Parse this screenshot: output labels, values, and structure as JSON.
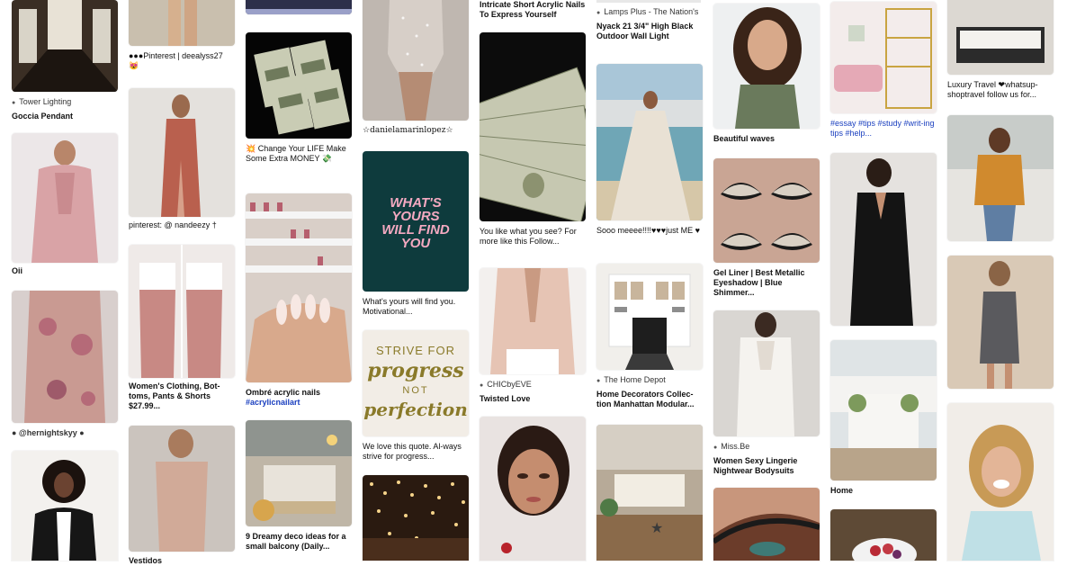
{
  "colors": {
    "link": "#1a3fbf",
    "quote_pink": "#f4a9c1",
    "quote_bg_dark": "#0e3b3d",
    "progress_gold": "#8a7a2a"
  },
  "pins": {
    "c1_1": {
      "source": "Tower Lighting",
      "title": "Goccia Pendant"
    },
    "c1_2": {
      "title": "Oii"
    },
    "c1_3": {
      "source": "● @hernightskyy ●"
    },
    "c2_1": {
      "title": "●●●Pinterest | deealyss27 😻"
    },
    "c2_2": {
      "title": "pinterest: @ nandeezy †"
    },
    "c2_3": {
      "title": "Women's Clothing, Bot-toms, Pants & Shorts $27.99..."
    },
    "c2_4": {
      "title": "Vestidos"
    },
    "c3_2": {
      "title": "💥 Change Your LIFE Make Some Extra MONEY 💸"
    },
    "c3_3": {
      "title": "Ombré acrylic nails",
      "tag": "#acrylicnailart"
    },
    "c3_4": {
      "title": "9 Dreamy deco ideas for a small balcony (Daily..."
    },
    "c4_1": {
      "overlay": "☆danielamarinlopez☆"
    },
    "c4_2": {
      "quote": [
        "WHAT'S",
        "YOURS",
        "WILL FIND",
        "YOU"
      ],
      "title": "What's yours will find you. Motivational..."
    },
    "c4_3": {
      "quote": [
        "STRIVE FOR",
        "progress",
        "NOT",
        "perfection"
      ],
      "title": "We love this quote. Al-ways strive for progress..."
    },
    "c5_1": {
      "title": "Intricate Short Acrylic Nails To Express Yourself"
    },
    "c5_2": {
      "title": "You like what you see? For more like this Follow..."
    },
    "c5_3": {
      "source": "CHICbyEVE",
      "title": "Twisted Love"
    },
    "c6_1": {
      "source": "Lamps Plus - The Nation's",
      "title": "Nyack 21 3/4\" High Black Outdoor Wall Light"
    },
    "c6_2": {
      "title": "Sooo meeee!!!!♥♥♥just ME ♥"
    },
    "c6_3": {
      "source": "The Home Depot",
      "title": "Home Decorators Collec-tion Manhattan Modular..."
    },
    "c7_1": {
      "title": "Beautiful waves"
    },
    "c7_2": {
      "title": "Gel Liner | Best Metallic Eyeshadow | Blue Shimmer..."
    },
    "c7_3": {
      "source": "Miss.Be",
      "title": "Women Sexy Lingerie Nightwear Bodysuits"
    },
    "c8_1": {
      "tags": "#essay #tips #study #writ-ing tips #help..."
    },
    "c8_3": {
      "title": "Home"
    },
    "c9_1": {
      "title": "Luxury Travel ❤whatsup-shoptravel follow us for..."
    }
  }
}
